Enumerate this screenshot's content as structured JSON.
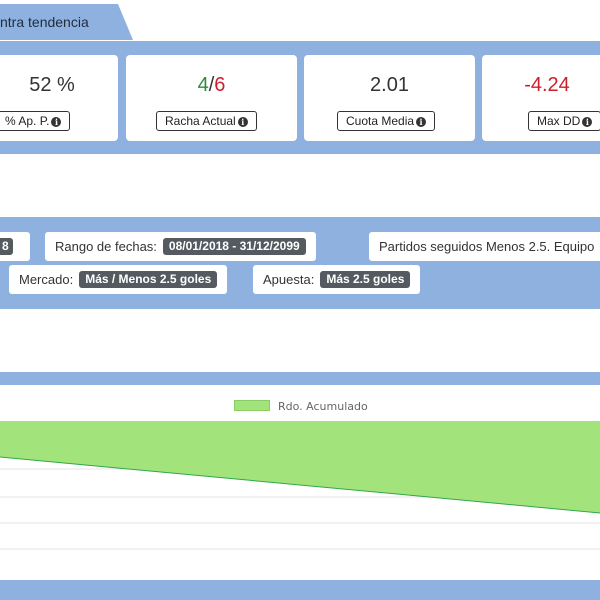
{
  "tab": {
    "label": "ntra tendencia"
  },
  "stats": {
    "pct_ap": {
      "value": "52 %",
      "label": "% Ap. P."
    },
    "racha": {
      "wins": "4",
      "sep": "/",
      "total": "6",
      "label": "Racha Actual"
    },
    "cuota": {
      "value": "2.01",
      "label": "Cuota Media"
    },
    "maxdd": {
      "value": "-4.24",
      "label": "Max DD"
    }
  },
  "info_icon": "i",
  "filters": {
    "season_fragment": "8",
    "rango": {
      "label": "Rango de fechas:",
      "value": "08/01/2018 - 31/12/2099"
    },
    "partidos": {
      "label": "Partidos seguidos Menos 2.5. Equipo"
    },
    "mercado": {
      "label": "Mercado:",
      "value": "Más / Menos 2.5 goles"
    },
    "apuesta": {
      "label": "Apuesta:",
      "value": "Más 2.5 goles"
    }
  },
  "colors": {
    "band": "#8fb1df",
    "area_fill": "#a3e37b",
    "area_line": "#2fa84a",
    "negative": "#cc1f2b",
    "positive": "#2e8b3a"
  },
  "chart_data": {
    "type": "area",
    "series": [
      {
        "name": "Rdo. Acumulado",
        "values": [
          1.0,
          0.0
        ],
        "note_position": "visible portion"
      }
    ],
    "legend": "top-center",
    "grid": true
  }
}
